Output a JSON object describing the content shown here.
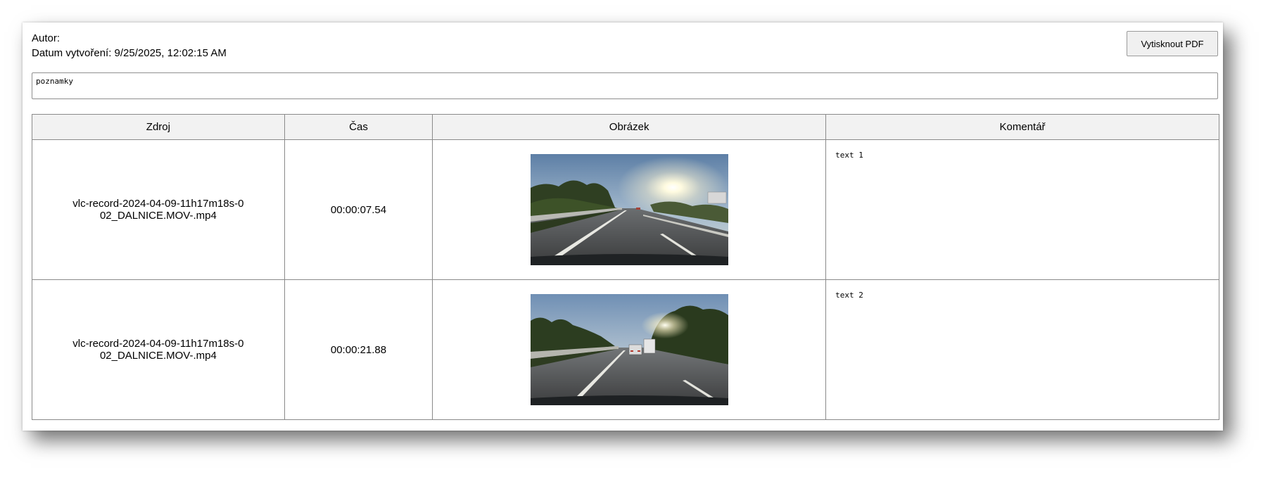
{
  "header": {
    "author_label": "Autor:",
    "created_label": "Datum vytvoření: 9/25/2025, 12:02:15 AM",
    "print_button": "Vytisknout PDF"
  },
  "notes": {
    "value": "poznamky"
  },
  "table": {
    "columns": [
      "Zdroj",
      "Čas",
      "Obrázek",
      "Komentář"
    ],
    "rows": [
      {
        "source": "vlc-record-2024-04-09-11h17m18s-002_DALNICE.MOV-.mp4",
        "time": "00:00:07.54",
        "image": "highway-dashcam-frame-sun",
        "comment": "text 1"
      },
      {
        "source": "vlc-record-2024-04-09-11h17m18s-002_DALNICE.MOV-.mp4",
        "time": "00:00:21.88",
        "image": "highway-dashcam-frame-traffic",
        "comment": "text 2"
      }
    ]
  }
}
